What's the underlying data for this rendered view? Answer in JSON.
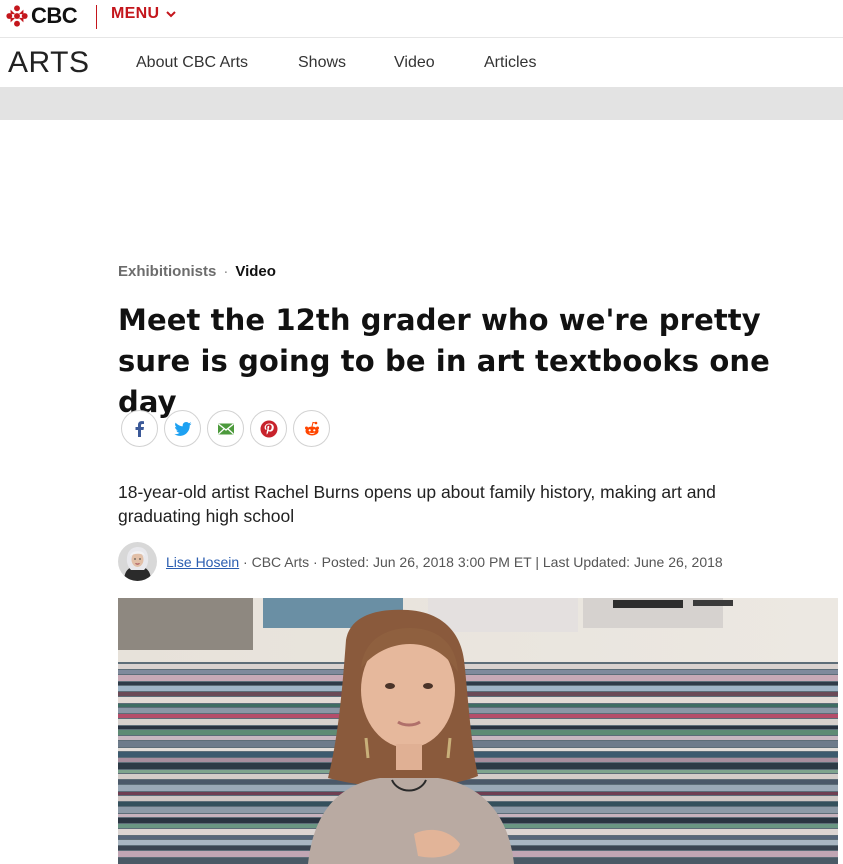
{
  "topbar": {
    "logo_text": "CBC",
    "menu_label": "MENU",
    "colors": {
      "brand_red": "#c4161c"
    }
  },
  "section_nav": {
    "title": "ARTS",
    "items": [
      {
        "label": "About CBC Arts"
      },
      {
        "label": "Shows"
      },
      {
        "label": "Video"
      },
      {
        "label": "Articles"
      }
    ]
  },
  "article": {
    "kicker_section": "Exhibitionists",
    "kicker_separator": "·",
    "kicker_type": "Video",
    "headline": "Meet the 12th grader who we're pretty sure is going to be in art textbooks one day",
    "share_buttons": [
      {
        "icon": "facebook-icon"
      },
      {
        "icon": "twitter-icon"
      },
      {
        "icon": "email-icon"
      },
      {
        "icon": "pinterest-icon"
      },
      {
        "icon": "reddit-icon"
      }
    ],
    "deck": "18-year-old artist Rachel Burns opens up about family history, making art and graduating high school",
    "byline": {
      "author": "Lise Hosein",
      "details": " · CBC Arts · Posted: Jun 26, 2018 3:00 PM ET | Last Updated: June 26, 2018"
    }
  }
}
